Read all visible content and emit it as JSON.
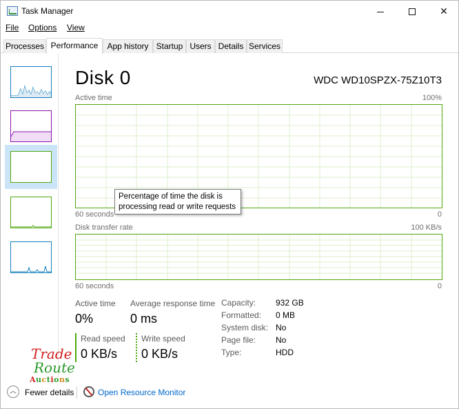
{
  "window": {
    "title": "Task Manager",
    "controls": [
      "minimize",
      "maximize",
      "close"
    ]
  },
  "menu": {
    "file": "File",
    "options": "Options",
    "view": "View"
  },
  "tabs": [
    {
      "label": "Processes"
    },
    {
      "label": "Performance",
      "active": true
    },
    {
      "label": "App history"
    },
    {
      "label": "Startup"
    },
    {
      "label": "Users"
    },
    {
      "label": "Details"
    },
    {
      "label": "Services"
    }
  ],
  "sidebar": {
    "items": [
      {
        "id": "cpu",
        "color": "#117dbb"
      },
      {
        "id": "memory",
        "color": "#8b12ae"
      },
      {
        "id": "disk0",
        "color": "#4da60c",
        "selected": true
      },
      {
        "id": "disk1",
        "color": "#4da60c"
      },
      {
        "id": "ethernet",
        "color": "#117dbb"
      }
    ]
  },
  "disk": {
    "title": "Disk 0",
    "model": "WDC WD10SPZX-75Z10T3",
    "graph1": {
      "label": "Active time",
      "max": "100%",
      "time_span": "60 seconds",
      "min": "0"
    },
    "graph2": {
      "label": "Disk transfer rate",
      "max": "100 KB/s",
      "time_span": "60 seconds",
      "min": "0"
    },
    "tooltip": {
      "line1": "Percentage of time the disk is",
      "line2": "processing read or write requests"
    },
    "stats": {
      "active_time_label": "Active time",
      "active_time_value": "0%",
      "avg_response_label": "Average response time",
      "avg_response_value": "0 ms",
      "read_speed_label": "Read speed",
      "read_speed_value": "0 KB/s",
      "write_speed_label": "Write speed",
      "write_speed_value": "0 KB/s"
    },
    "properties": [
      {
        "key": "Capacity:",
        "value": "932 GB"
      },
      {
        "key": "Formatted:",
        "value": "0 MB"
      },
      {
        "key": "System disk:",
        "value": "No"
      },
      {
        "key": "Page file:",
        "value": "No"
      },
      {
        "key": "Type:",
        "value": "HDD"
      }
    ]
  },
  "watermark": {
    "line1": "Trade",
    "line2": "Route",
    "line3": "Auctions"
  },
  "footer": {
    "fewer_details": "Fewer details",
    "open_resource_monitor": "Open Resource Monitor"
  },
  "colors": {
    "disk_accent": "#4da60c",
    "cpu_accent": "#117dbb",
    "memory_accent": "#8b12ae",
    "link": "#0066cc",
    "selected_bg": "#cce4f7"
  }
}
